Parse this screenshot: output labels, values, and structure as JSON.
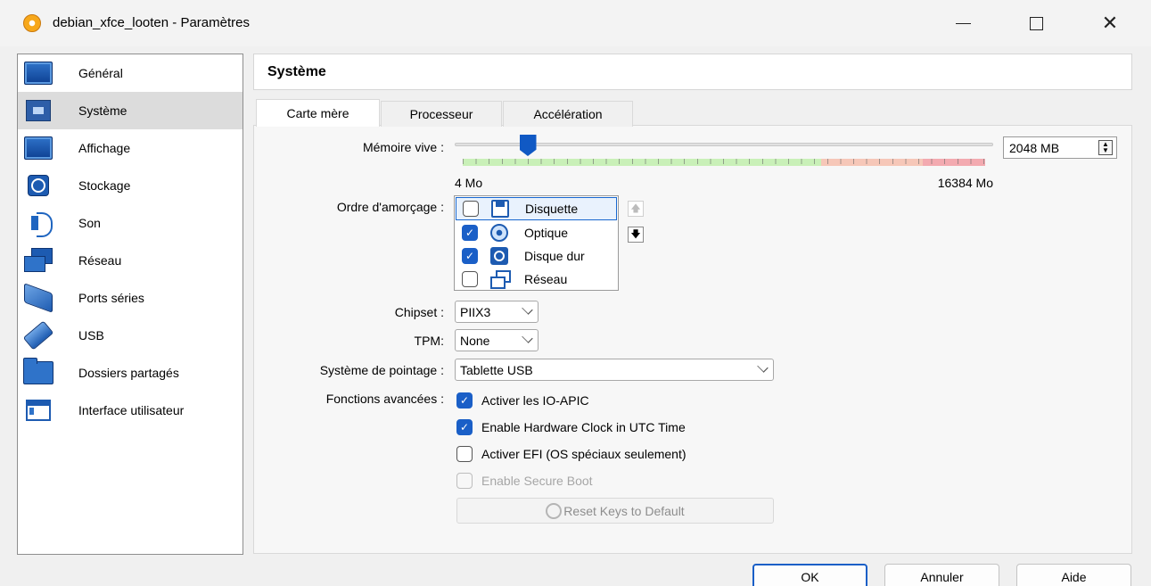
{
  "window": {
    "title": "debian_xfce_looten - Paramètres",
    "minimize": "—",
    "maximize": "☐",
    "close": "✕"
  },
  "sidebar": {
    "items": [
      {
        "label": "Général",
        "icon": "monitor-icon"
      },
      {
        "label": "Système",
        "icon": "chip-icon",
        "selected": true
      },
      {
        "label": "Affichage",
        "icon": "display-icon"
      },
      {
        "label": "Stockage",
        "icon": "disk-icon"
      },
      {
        "label": "Son",
        "icon": "speaker-icon"
      },
      {
        "label": "Réseau",
        "icon": "network-icon"
      },
      {
        "label": "Ports séries",
        "icon": "serial-port-icon"
      },
      {
        "label": "USB",
        "icon": "usb-icon"
      },
      {
        "label": "Dossiers partagés",
        "icon": "folder-icon"
      },
      {
        "label": "Interface utilisateur",
        "icon": "window-icon"
      }
    ]
  },
  "page": {
    "title": "Système",
    "tabs": [
      {
        "label": "Carte mère",
        "active": true
      },
      {
        "label": "Processeur",
        "active": false
      },
      {
        "label": "Accélération",
        "active": false
      }
    ]
  },
  "memory": {
    "label": "Mémoire vive :",
    "value": "2048 MB",
    "min_label": "4 Mo",
    "max_label": "16384 Mo",
    "level_fraction": 0.125,
    "zones": {
      "green": "#c9f0b8",
      "orange": "#f6c7b8",
      "red": "#f3aab0"
    }
  },
  "boot": {
    "label": "Ordre d'amorçage :",
    "items": [
      {
        "label": "Disquette",
        "checked": false,
        "icon": "floppy-icon"
      },
      {
        "label": "Optique",
        "checked": true,
        "icon": "optical-disc-icon"
      },
      {
        "label": "Disque dur",
        "checked": true,
        "icon": "hard-disk-icon"
      },
      {
        "label": "Réseau",
        "checked": false,
        "icon": "network-icon"
      }
    ],
    "up": "🡅",
    "down": "🡇"
  },
  "chipset": {
    "label": "Chipset :",
    "value": "PIIX3"
  },
  "tpm": {
    "label": "TPM:",
    "value": "None"
  },
  "pointing": {
    "label": "Système de pointage :",
    "value": "Tablette USB"
  },
  "advanced": {
    "label": "Fonctions avancées :",
    "options": [
      {
        "label": "Activer les IO-APIC",
        "checked": true,
        "enabled": true
      },
      {
        "label": "Enable Hardware Clock in UTC Time",
        "checked": true,
        "enabled": true
      },
      {
        "label": "Activer EFI (OS spéciaux seulement)",
        "checked": false,
        "enabled": true
      },
      {
        "label": "Enable Secure Boot",
        "checked": false,
        "enabled": false
      }
    ],
    "reset_keys": "Reset Keys to Default"
  },
  "buttons": {
    "ok": "OK",
    "cancel": "Annuler",
    "help": "Aide"
  },
  "colors": {
    "accent": "#1a5fc7",
    "selection": "#dcdcdc"
  }
}
